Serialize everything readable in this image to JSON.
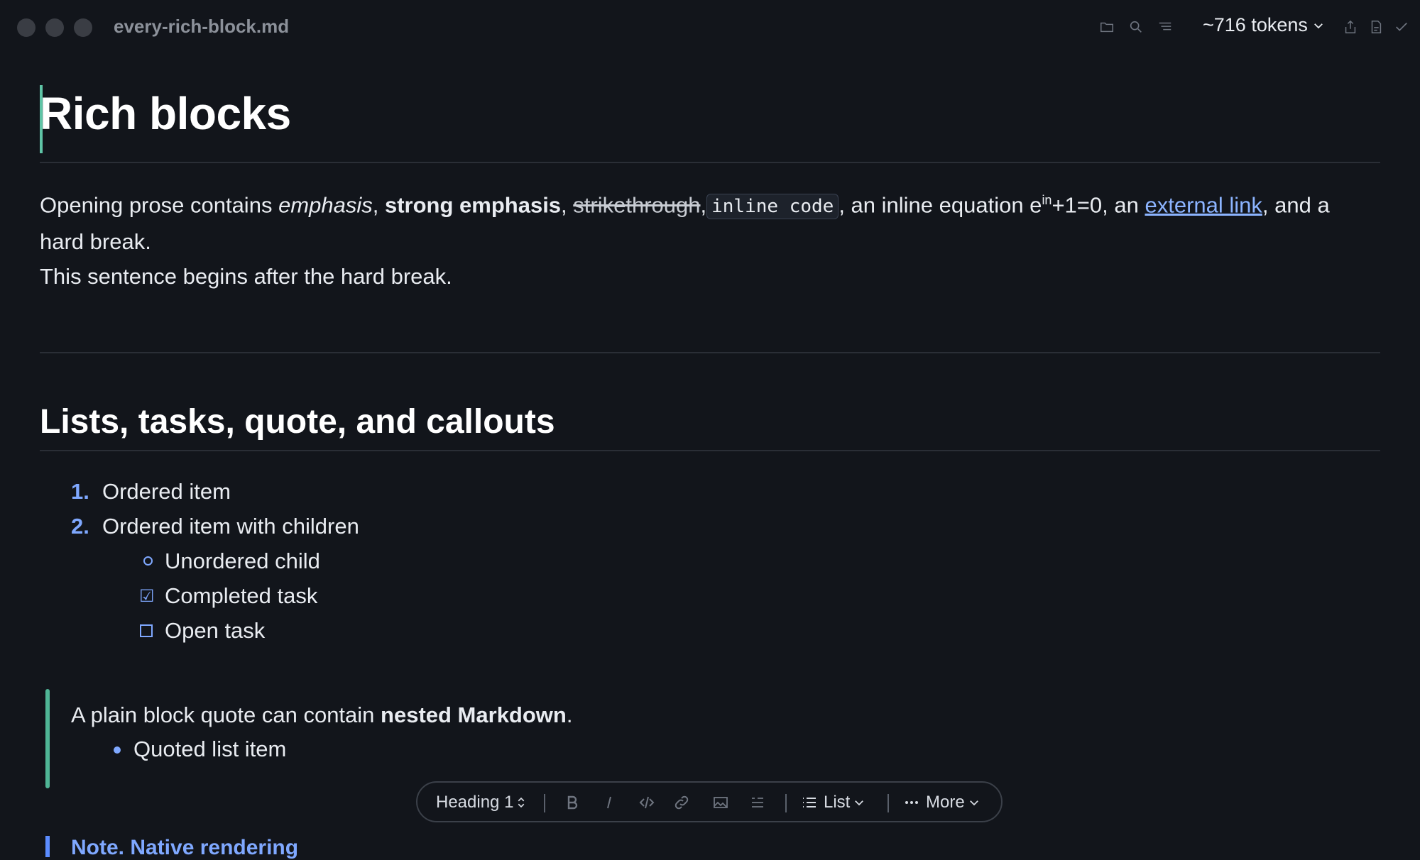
{
  "window": {
    "filename": "every-rich-block.md",
    "tokens_label": "~716 tokens",
    "icons": [
      "folder-icon",
      "search-icon",
      "outline-icon",
      "share-icon",
      "export-icon",
      "check-icon"
    ]
  },
  "doc": {
    "h1": "Rich blocks",
    "para": {
      "t1": "Opening prose contains ",
      "emphasis": "emphasis",
      "t2": ", ",
      "strong": "strong emphasis",
      "t3": ", ",
      "strike": "strikethrough",
      "t4": ",",
      "code": "inline code",
      "t5": ", an inline equation e",
      "sup": "in",
      "t6": "+1=0, an ",
      "link": "external link",
      "t7": ", and a hard break.",
      "line2": "This sentence begins after the hard break."
    },
    "h2": "Lists, tasks, quote, and callouts",
    "ordered": [
      {
        "num": "1.",
        "text": "Ordered item"
      },
      {
        "num": "2.",
        "text": "Ordered item with children"
      }
    ],
    "children": [
      {
        "kind": "bullet",
        "text": "Unordered child"
      },
      {
        "kind": "task-done",
        "mark": "☑",
        "text": "Completed task"
      },
      {
        "kind": "task-open",
        "text": "Open task"
      }
    ],
    "quote": {
      "t1": "A plain block quote can contain ",
      "strong": "nested Markdown",
      "t2": ".",
      "item": "Quoted list item"
    },
    "callout_title": "Note. Native rendering"
  },
  "toolbar": {
    "heading": "Heading 1",
    "list": "List",
    "more": "More"
  },
  "colors": {
    "accent_green": "#5fc4a6",
    "accent_blue": "#7fa8ff",
    "background": "#12151b"
  }
}
